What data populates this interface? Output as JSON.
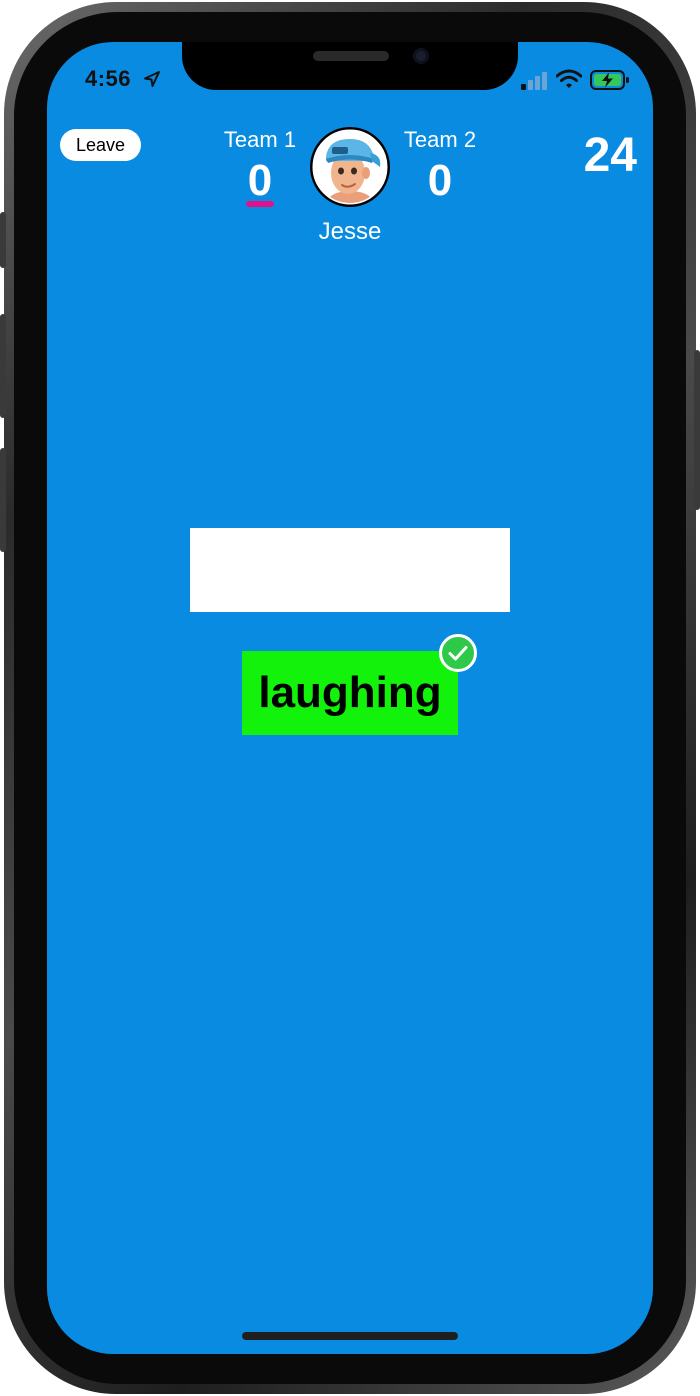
{
  "status_bar": {
    "time": "4:56",
    "icons": [
      "location-arrow-icon",
      "signal-icon",
      "wifi-icon",
      "battery-charging-icon"
    ]
  },
  "header": {
    "leave_label": "Leave",
    "team1": {
      "label": "Team 1",
      "score": "0"
    },
    "team2": {
      "label": "Team 2",
      "score": "0"
    },
    "player_name": "Jesse",
    "timer": "24"
  },
  "game": {
    "answer_value": "",
    "word": "laughing",
    "word_status_icon": "checkmark-circle-icon"
  },
  "colors": {
    "background": "#0a8be2",
    "word_card": "#12f20b",
    "active_team_marker": "#e0128a",
    "check": "#2fc94a"
  }
}
